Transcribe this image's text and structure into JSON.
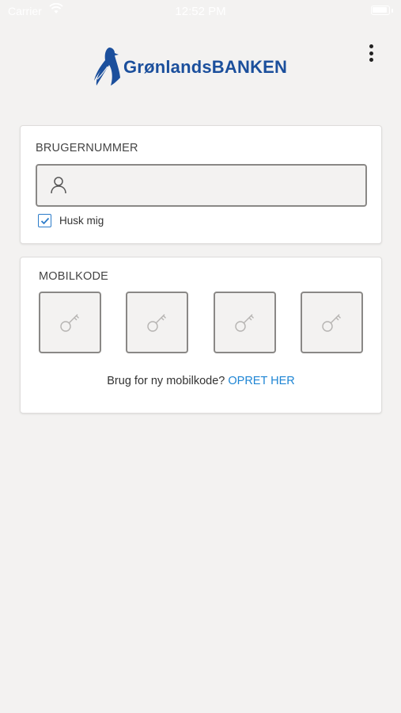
{
  "status_bar": {
    "carrier": "Carrier",
    "time": "12:52 PM",
    "icons": [
      "wifi-icon",
      "battery-icon"
    ]
  },
  "header": {
    "logo_text": "GrønlandsBANKEN",
    "logo_icon": "penguin-logo-icon",
    "menu_icon": "more-vertical-icon"
  },
  "login": {
    "username_title": "BRUGERNUMMER",
    "username_value": "",
    "username_icon": "user-icon",
    "remember_label": "Husk mig",
    "remember_checked": true
  },
  "mobile_code": {
    "title": "MOBILKODE",
    "slots": [
      {
        "icon": "key-icon"
      },
      {
        "icon": "key-icon"
      },
      {
        "icon": "key-icon"
      },
      {
        "icon": "key-icon"
      }
    ],
    "prompt_text": "Brug for ny mobilkode?",
    "create_link": "OPRET HER"
  },
  "colors": {
    "background": "#f3f2f1",
    "brand_blue": "#1b4f9c",
    "link_blue": "#1e85d4",
    "checkbox_blue": "#2b7bc9",
    "field_border": "#8a8886"
  }
}
